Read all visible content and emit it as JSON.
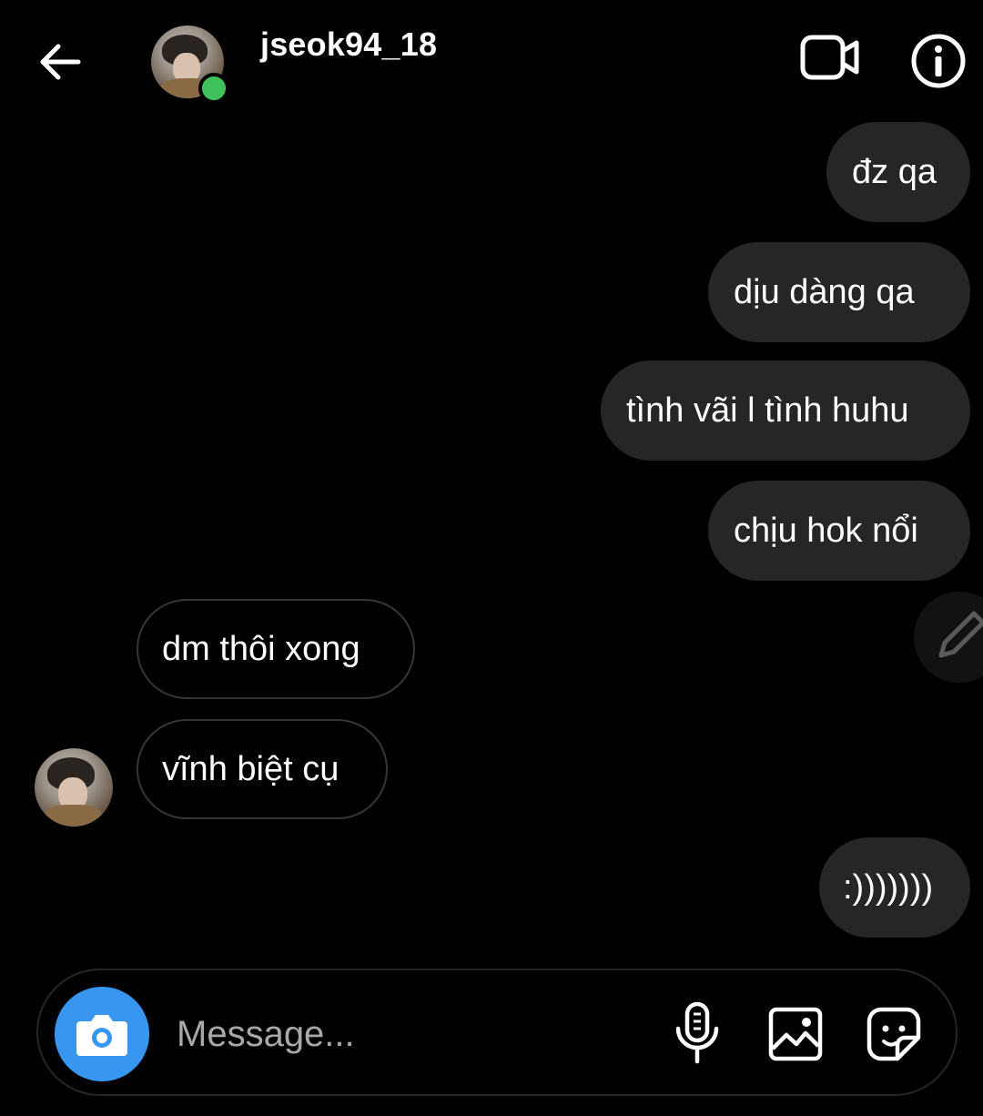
{
  "header": {
    "username": "jseok94_18",
    "back_icon": "arrow-left-icon",
    "video_icon": "video-camera-icon",
    "info_icon": "info-icon",
    "online_color": "#3ec15b"
  },
  "messages": [
    {
      "sender": "me",
      "text": "đz qa"
    },
    {
      "sender": "me",
      "text": "dịu dàng qa"
    },
    {
      "sender": "me",
      "text": "tình vãi l tình huhu"
    },
    {
      "sender": "me",
      "text": "chịu hok nổi"
    },
    {
      "sender": "them",
      "text": "dm thôi xong"
    },
    {
      "sender": "them",
      "text": "vĩnh biệt cụ"
    },
    {
      "sender": "me",
      "text": ":)))))))"
    }
  ],
  "composer": {
    "placeholder": "Message...",
    "camera_icon": "camera-icon",
    "mic_icon": "microphone-icon",
    "gallery_icon": "gallery-icon",
    "sticker_icon": "sticker-icon",
    "accent_color": "#3797f0"
  },
  "colors": {
    "background": "#000000",
    "outgoing_bubble": "#262626",
    "incoming_border": "#363636"
  }
}
